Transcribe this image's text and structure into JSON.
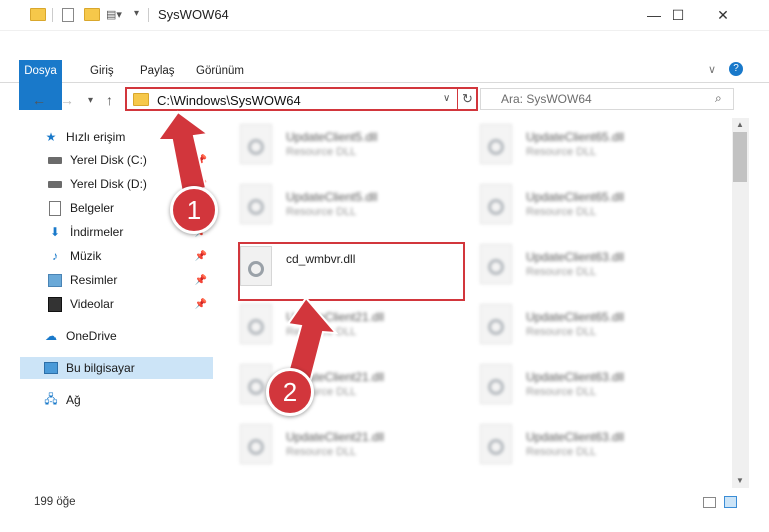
{
  "window": {
    "title": "SysWOW64",
    "minimize": "—",
    "maximize": "☐",
    "close": "✕"
  },
  "ribbon": {
    "tabs": [
      "Dosya",
      "Giriş",
      "Paylaş",
      "Görünüm"
    ]
  },
  "address": {
    "path": "C:\\Windows\\SysWOW64"
  },
  "search": {
    "placeholder": "Ara: SysWOW64"
  },
  "sidebar": {
    "items": [
      {
        "label": "Hızlı erişim"
      },
      {
        "label": "Yerel Disk (C:)"
      },
      {
        "label": "Yerel Disk (D:)"
      },
      {
        "label": "Belgeler"
      },
      {
        "label": "İndirmeler"
      },
      {
        "label": "Müzik"
      },
      {
        "label": "Resimler"
      },
      {
        "label": "Videolar"
      },
      {
        "label": "OneDrive"
      },
      {
        "label": "Bu bilgisayar"
      },
      {
        "label": "Ağ"
      }
    ]
  },
  "files": {
    "left": [
      {
        "name": "UpdateClient5.dll",
        "type": "Resource DLL"
      },
      {
        "name": "UpdateClient5.dll",
        "type": "Resource DLL"
      },
      {
        "name": "cd_wmbvr.dll",
        "type": ""
      },
      {
        "name": "UpdateClient21.dll",
        "type": "Resource DLL"
      },
      {
        "name": "UpdateClient21.dll",
        "type": "Resource DLL"
      },
      {
        "name": "UpdateClient21.dll",
        "type": "Resource DLL"
      }
    ],
    "right": [
      {
        "name": "UpdateClient65.dll",
        "type": "Resource DLL"
      },
      {
        "name": "UpdateClient65.dll",
        "type": "Resource DLL"
      },
      {
        "name": "UpdateClient63.dll",
        "type": "Resource DLL"
      },
      {
        "name": "UpdateClient65.dll",
        "type": "Resource DLL"
      },
      {
        "name": "UpdateClient63.dll",
        "type": "Resource DLL"
      },
      {
        "name": "UpdateClient63.dll",
        "type": "Resource DLL"
      }
    ]
  },
  "status": {
    "count": "199 öğe"
  },
  "annotations": {
    "step1": "1",
    "step2": "2"
  },
  "colors": {
    "accent": "#1979ca",
    "highlight": "#d2363c"
  }
}
